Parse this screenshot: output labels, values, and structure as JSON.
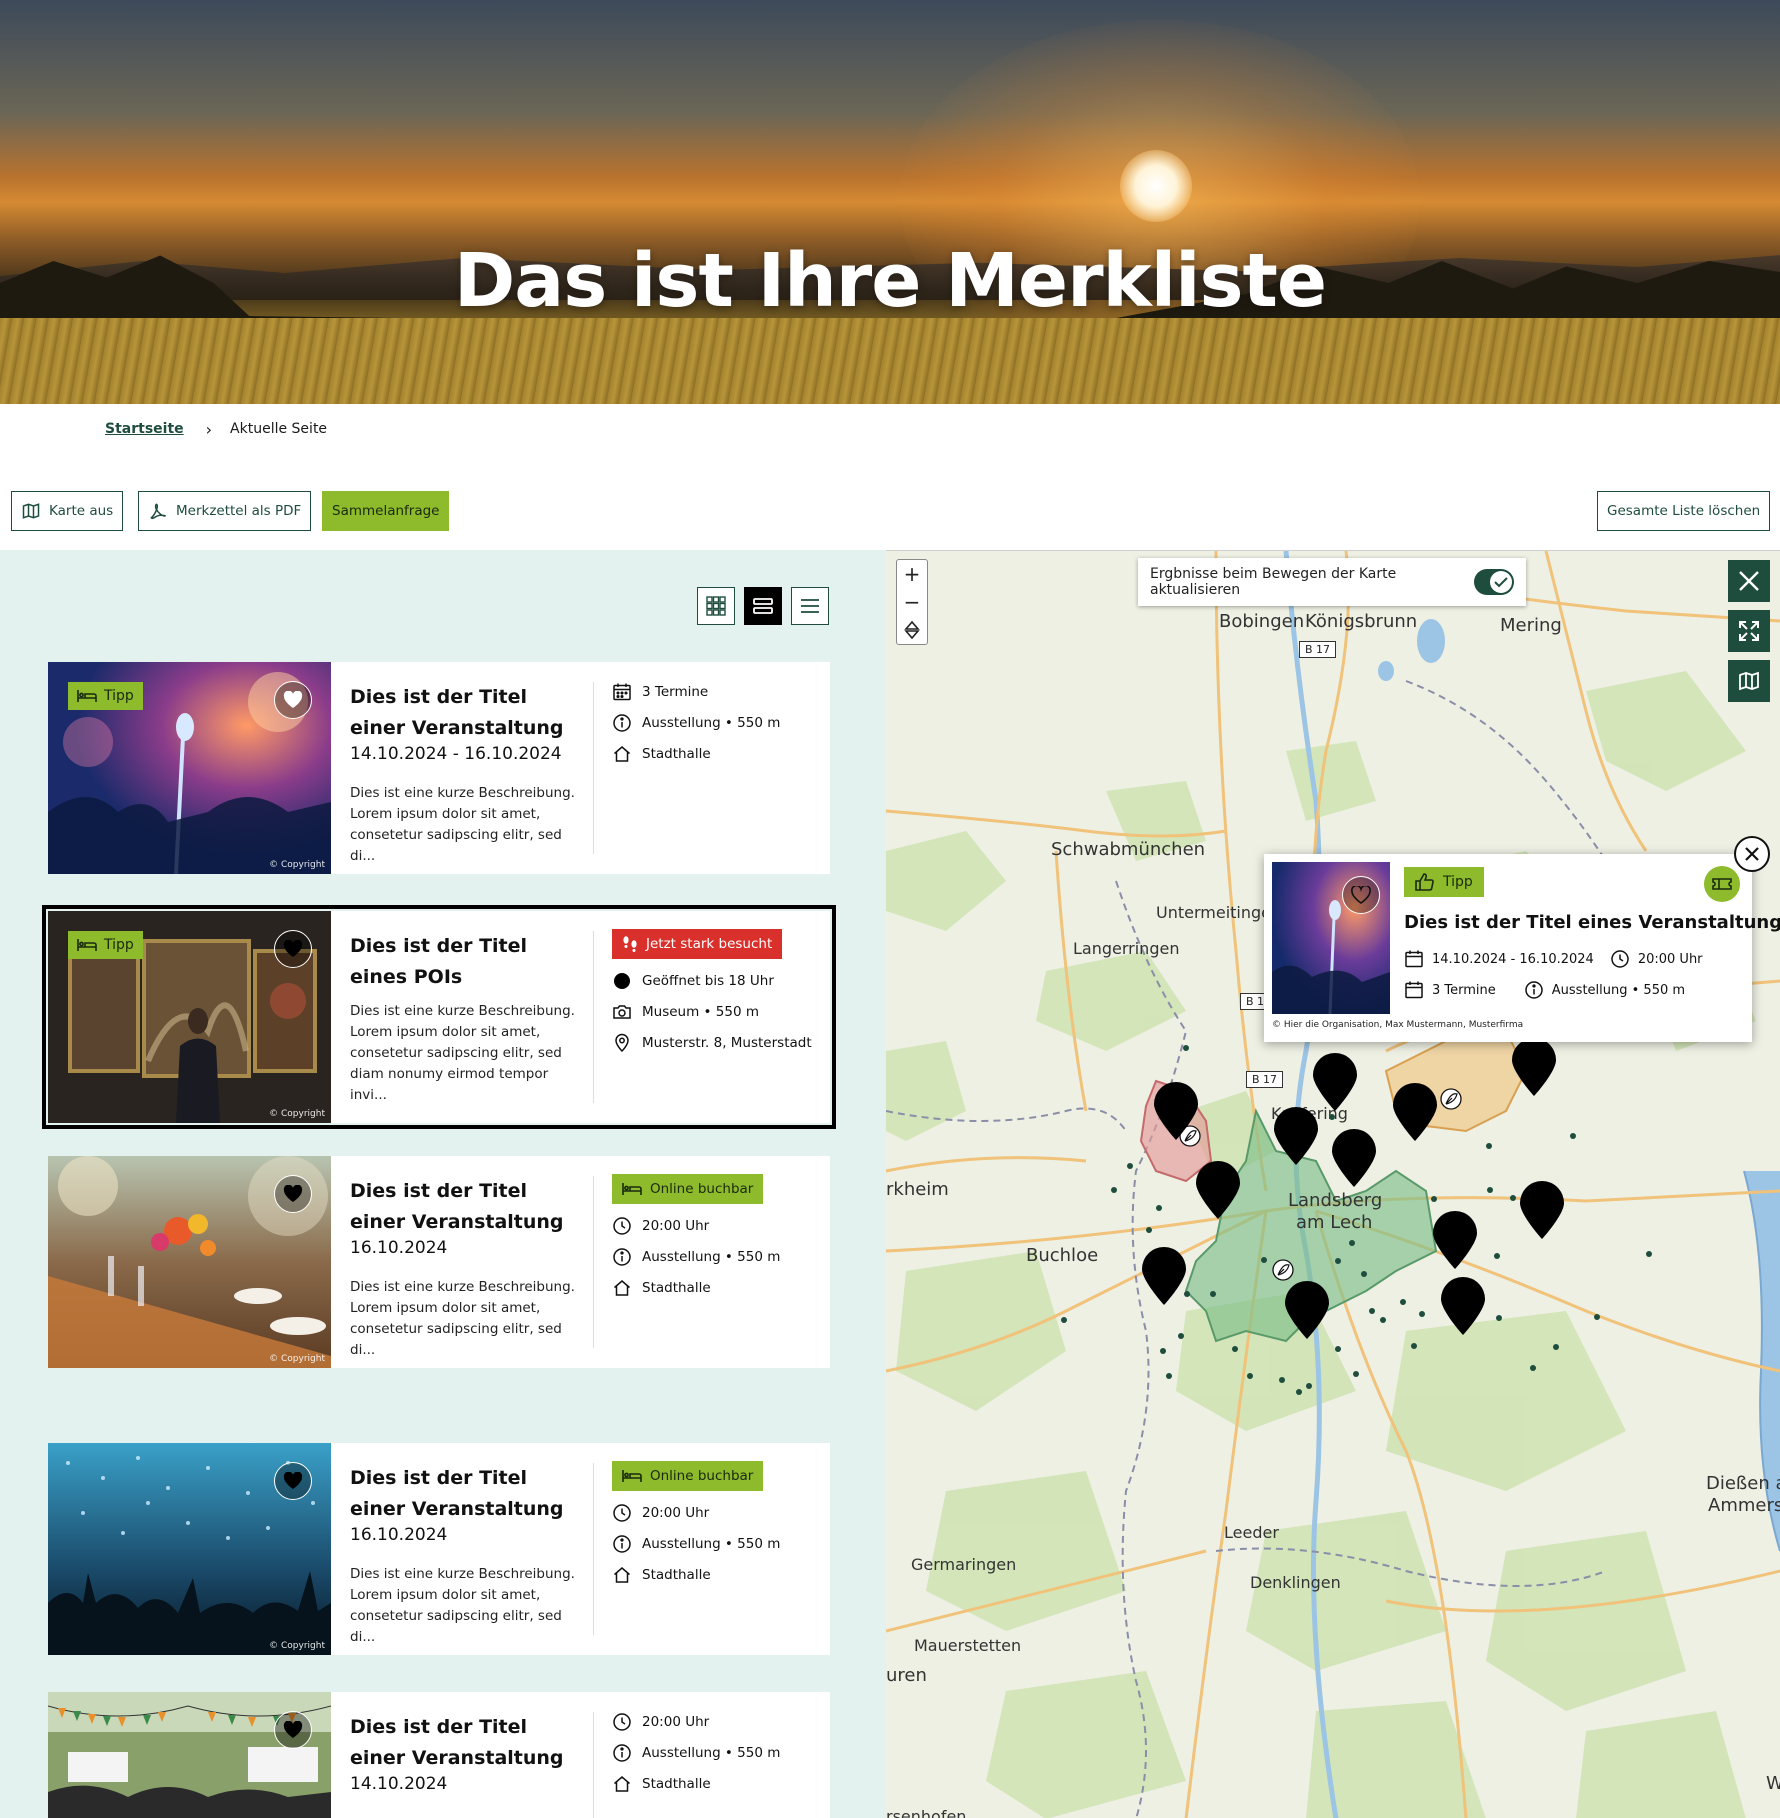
{
  "hero": {
    "title": "Das ist Ihre Merkliste"
  },
  "breadcrumb": {
    "home": "Startseite",
    "current": "Aktuelle Seite"
  },
  "toolbar": {
    "map_off": "Karte aus",
    "pdf": "Merkzettel als PDF",
    "bulk_request": "Sammelanfrage",
    "clear_all": "Gesamte Liste löschen"
  },
  "view_modes": [
    "grid-view",
    "card-list-view",
    "compact-list-view"
  ],
  "cards": [
    {
      "tipp": "Tipp",
      "copyright": "© Copyright",
      "title": "Dies ist der Titel einer Veranstaltung",
      "date": "14.10.2024 - 16.10.2024",
      "desc": "Dies ist eine kurze Beschreibung. Lorem ipsum dolor sit amet, consetetur sadipscing elitr, sed di...",
      "meta": [
        "3 Termine",
        "Ausstellung • 550 m",
        "Stadthalle"
      ]
    },
    {
      "tipp": "Tipp",
      "copyright": "© Copyright",
      "title": "Dies ist der Titel eines POIs",
      "desc": "Dies ist eine kurze Beschreibung. Lorem ipsum dolor sit amet, consetetur sadipscing elitr, sed diam nonumy eirmod tempor invi...",
      "badge": "Jetzt stark besucht",
      "meta": [
        "Geöffnet bis 18 Uhr",
        "Museum • 550 m",
        "Musterstr. 8, Musterstadt"
      ]
    },
    {
      "copyright": "© Copyright",
      "title": "Dies ist der Titel einer Veranstaltung",
      "date": "16.10.2024",
      "desc": "Dies ist eine kurze Beschreibung. Lorem ipsum dolor sit amet, consetetur sadipscing elitr, sed di...",
      "badge": "Online buchbar",
      "meta": [
        "20:00 Uhr",
        "Ausstellung • 550 m",
        "Stadthalle"
      ]
    },
    {
      "copyright": "© Copyright",
      "title": "Dies ist der Titel einer Veranstaltung",
      "date": "16.10.2024",
      "desc": "Dies ist eine kurze Beschreibung. Lorem ipsum dolor sit amet, consetetur sadipscing elitr, sed di...",
      "badge": "Online buchbar",
      "meta": [
        "20:00 Uhr",
        "Ausstellung • 550 m",
        "Stadthalle"
      ]
    },
    {
      "title": "Dies ist der Titel einer Veranstaltung",
      "date": "14.10.2024",
      "meta": [
        "20:00 Uhr",
        "Ausstellung • 550 m",
        "Stadthalle"
      ]
    }
  ],
  "map": {
    "update_toggle_label": "Ergbnisse beim Bewegen der Karte aktualisieren",
    "update_toggle_on": true,
    "labels": {
      "bobingen": "Bobingen",
      "koenigsbrunn": "Königsbrunn",
      "mering": "Mering",
      "schwabmuenchen": "Schwabmünchen",
      "untermeitingen": "Untermeitingen",
      "langerringen": "Langerringen",
      "kaufering": "Kaufering",
      "landsberg": "Landsberg",
      "am_lech": "am Lech",
      "buchloe": "Buchloe",
      "rkheim": "rkheim",
      "leeder": "Leeder",
      "denklingen": "Denklingen",
      "germaringen": "Germaringen",
      "mauerstetten": "Mauerstetten",
      "uren": "uren",
      "diessen": "Dießen a",
      "ammerse": "Ammerse",
      "rsenhofen": "rsenhofen",
      "w": "W"
    },
    "road_signs": [
      "B 17",
      "B 17",
      "B 1"
    ],
    "zoom_in": "+",
    "zoom_out": "−"
  },
  "popup": {
    "tipp": "Tipp",
    "title": "Dies ist der Titel eines Veranstaltung",
    "date": "14.10.2024 - 16.10.2024",
    "time": "20:00 Uhr",
    "dates_count": "3 Termine",
    "category": "Ausstellung • 550 m",
    "copyright": "© Hier die Organisation, Max Mustermann, Musterfirma"
  },
  "colors": {
    "brand_green": "#1e4d3e",
    "accent_lime": "#8dbb2b",
    "alert_red": "#d9302b",
    "panel_bg": "#e3f1ef"
  }
}
